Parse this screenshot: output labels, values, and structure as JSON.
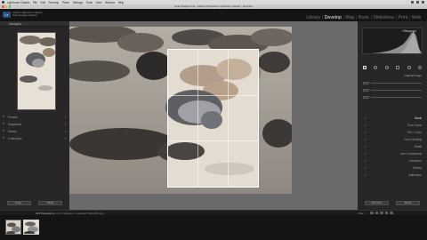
{
  "menubar": {
    "items": [
      "Lightroom Classic",
      "File",
      "Edit",
      "Develop",
      "Photo",
      "Settings",
      "Tools",
      "View",
      "Window",
      "Help"
    ]
  },
  "window": {
    "title": "Seal Images.lrcat - Adobe Photoshop Lightroom Classic - Develop"
  },
  "identity": {
    "badge": "Lr",
    "line1": "Adobe Lightroom Classic",
    "line2": "Seal Images Catalog"
  },
  "modules": [
    {
      "label": "Library",
      "active": false
    },
    {
      "label": "Develop",
      "active": true
    },
    {
      "label": "Map",
      "active": false
    },
    {
      "label": "Book",
      "active": false
    },
    {
      "label": "Slideshow",
      "active": false
    },
    {
      "label": "Print",
      "active": false
    },
    {
      "label": "Web",
      "active": false
    }
  ],
  "left_panel": {
    "navigator_title": "Navigator",
    "sections": [
      "Presets",
      "Snapshots",
      "History",
      "Collections"
    ],
    "copy_button": "Copy...",
    "paste_button": "Paste"
  },
  "right_panel": {
    "histogram_title": "Histogram",
    "crop_label": "Original Image",
    "sections": [
      "Basic",
      "Tone Curve",
      "HSL / Color",
      "Color Grading",
      "Detail",
      "Lens Corrections",
      "Transform",
      "Effects",
      "Calibration"
    ],
    "previous_button": "Previous",
    "reset_button": "Reset"
  },
  "toolbar": {
    "film_text": "All Photographs",
    "film_count": "1 of 15 photos / 1 selected",
    "filename": "/SEAL001.jpg",
    "filter_label": "Filter:",
    "star_count": 5
  },
  "colors": {
    "accent": "#2a4d7a",
    "panel": "#262626",
    "canvas": "#6b6b6b"
  }
}
